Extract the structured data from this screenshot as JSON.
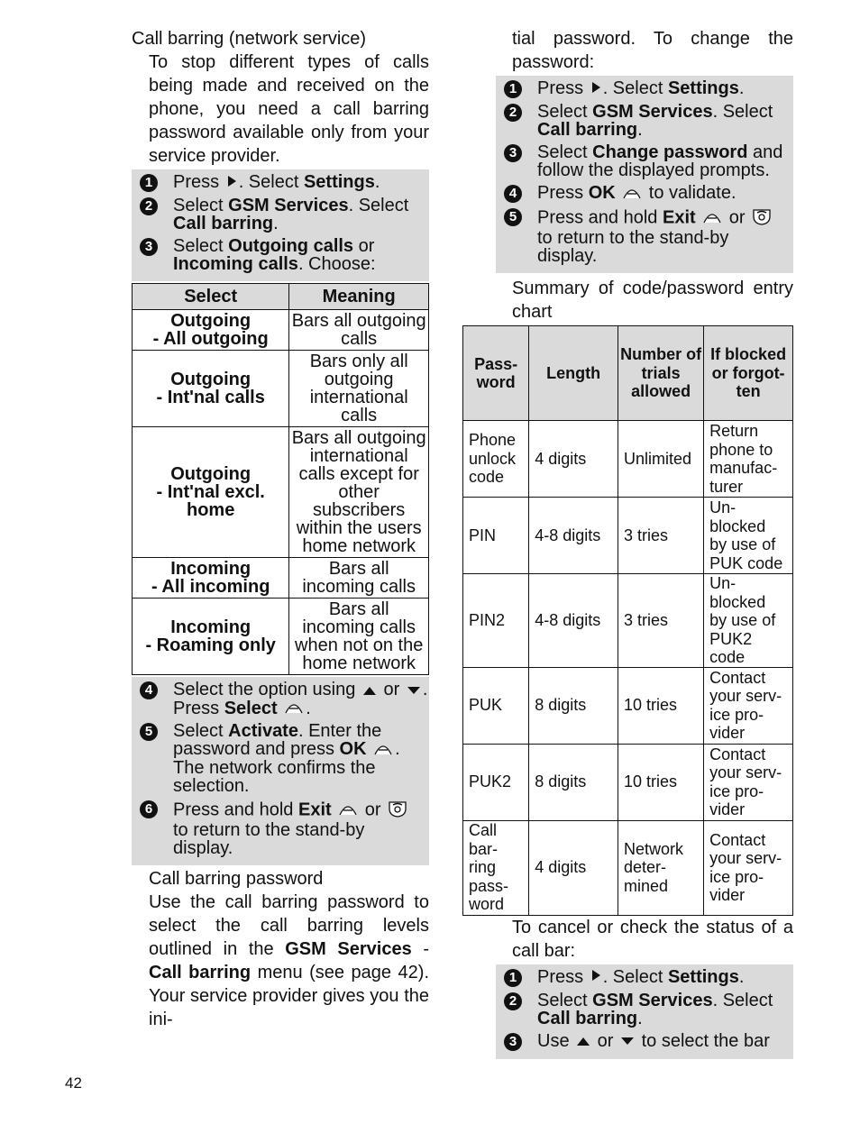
{
  "page_number": "42",
  "left": {
    "heading": "Call barring (network service)",
    "intro": "To stop different types of calls being made and received on the phone, you need a call barring password available only from your service provider.",
    "steps1": [
      [
        "Press ",
        {
          "i": "play"
        },
        ". Select ",
        {
          "b": "Settings"
        },
        "."
      ],
      [
        "Select ",
        {
          "b": "GSM Services"
        },
        ". Select ",
        {
          "b": "Call barring"
        },
        "."
      ],
      [
        "Select ",
        {
          "b": "Outgoing calls"
        },
        " or ",
        {
          "b": "Incoming calls"
        },
        ". Choose:"
      ]
    ],
    "table": {
      "headers": [
        "Select",
        "Meaning"
      ],
      "rows": [
        [
          "Outgoing\n- All outgoing",
          "Bars all outgoing calls"
        ],
        [
          "Outgoing\n- Int'nal calls",
          "Bars only all outgoing international calls"
        ],
        [
          "Outgoing\n- Int'nal excl. home",
          "Bars all outgoing international calls except for other subscribers within the users home network"
        ],
        [
          "Incoming\n- All incoming",
          "Bars all incoming calls"
        ],
        [
          "Incoming\n- Roaming only",
          "Bars all incoming calls when not on the home network"
        ]
      ]
    },
    "steps2": [
      [
        "Select the option using ",
        {
          "i": "up"
        },
        " or ",
        {
          "i": "down"
        },
        ". Press ",
        {
          "b": "Select"
        },
        " ",
        {
          "i": "soft"
        },
        "."
      ],
      [
        "Select ",
        {
          "b": "Activate"
        },
        ". Enter the password and press ",
        {
          "b": "OK"
        },
        " ",
        {
          "i": "soft"
        },
        ". The network confirms the selection."
      ],
      [
        "Press and hold ",
        {
          "b": "Exit"
        },
        " ",
        {
          "i": "soft"
        },
        " or ",
        {
          "i": "end"
        },
        " to return to the stand-by display."
      ]
    ],
    "steps2_start": 4,
    "heading2": "Call barring password",
    "para2": [
      "Use the call barring password to select the call barring levels outlined in the ",
      {
        "b": "GSM Services"
      },
      " - ",
      {
        "b": "Call barring"
      },
      " menu (see page 42). Your service provider gives you the ini-"
    ]
  },
  "right": {
    "para1": "tial password. To change the password:",
    "steps1": [
      [
        "Press ",
        {
          "i": "play"
        },
        ". Select ",
        {
          "b": "Settings"
        },
        "."
      ],
      [
        "Select ",
        {
          "b": "GSM Services"
        },
        ". Select ",
        {
          "b": "Call barring"
        },
        "."
      ],
      [
        "Select ",
        {
          "b": "Change password"
        },
        " and follow the displayed prompts."
      ],
      [
        "Press ",
        {
          "b": "OK"
        },
        " ",
        {
          "i": "soft"
        },
        " to validate."
      ],
      [
        "Press and hold ",
        {
          "b": "Exit"
        },
        " ",
        {
          "i": "soft"
        },
        " or ",
        {
          "i": "end"
        },
        " to return to the stand-by display."
      ]
    ],
    "para2": "Summary of code/password entry chart",
    "table": {
      "headers": [
        "Pass-\nword",
        "Length",
        "Number of trials allowed",
        "If blocked or forgot-\nten"
      ],
      "rows": [
        [
          "Phone unlock code",
          "4 digits",
          "Unlimited",
          "Return phone to manufac-\nturer"
        ],
        [
          "PIN",
          "4-8 digits",
          "3 tries",
          "Un-\nblocked by use of PUK code"
        ],
        [
          "PIN2",
          "4-8 digits",
          "3 tries",
          "Un-\nblocked by use of PUK2 code"
        ],
        [
          "PUK",
          "8 digits",
          "10 tries",
          "Contact your serv-\nice pro-\nvider"
        ],
        [
          "PUK2",
          "8 digits",
          "10 tries",
          "Contact your serv-\nice pro-\nvider"
        ],
        [
          "Call bar-\nring pass-\nword",
          "4 digits",
          "Network deter-\nmined",
          "Contact your serv-\nice pro-\nvider"
        ]
      ]
    },
    "para3": "To cancel or check the status of a call bar:",
    "steps2": [
      [
        "Press ",
        {
          "i": "play"
        },
        ". Select ",
        {
          "b": "Settings"
        },
        "."
      ],
      [
        "Select ",
        {
          "b": "GSM Services"
        },
        ". Select ",
        {
          "b": "Call barring"
        },
        "."
      ],
      [
        "Use ",
        {
          "i": "up"
        },
        " or ",
        {
          "i": "down"
        },
        " to select the bar"
      ]
    ]
  }
}
